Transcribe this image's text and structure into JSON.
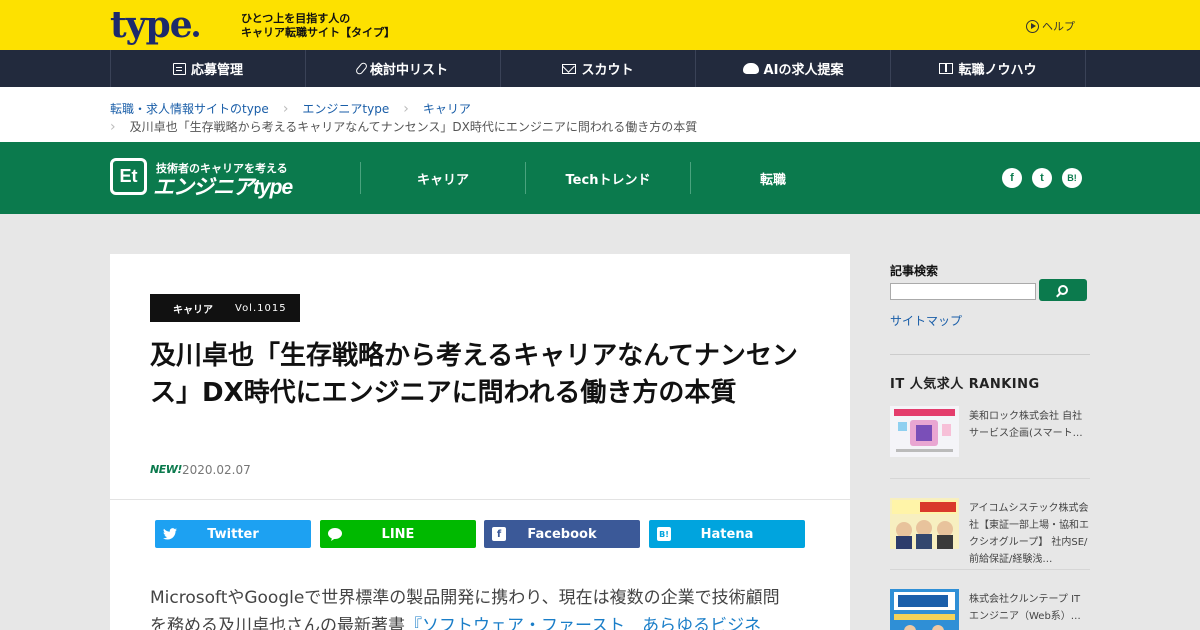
{
  "header": {
    "logo": "type",
    "tagline_line1": "ひとつ上を目指す人の",
    "tagline_line2": "キャリア転職サイト【タイプ】",
    "help": "ヘルプ"
  },
  "main_nav": [
    {
      "label": "応募管理",
      "icon": "document-icon"
    },
    {
      "label": "検討中リスト",
      "icon": "paperclip-icon"
    },
    {
      "label": "スカウト",
      "icon": "mail-icon"
    },
    {
      "label": "AIの求人提案",
      "icon": "ai-robot-icon"
    },
    {
      "label": "転職ノウハウ",
      "icon": "book-icon"
    }
  ],
  "breadcrumb": {
    "items": [
      "転職・求人情報サイトのtype",
      "エンジニアtype",
      "キャリア"
    ],
    "current": "及川卓也「生存戦略から考えるキャリアなんてナンセンス」DX時代にエンジニアに問われる働き方の本質"
  },
  "engineer_nav": {
    "logo_mark": "Et",
    "logo_small": "技術者のキャリアを考える",
    "logo_big": "エンジニアtype",
    "links": [
      "キャリア",
      "Techトレンド",
      "転職"
    ],
    "social": [
      "f",
      "t",
      "B!"
    ]
  },
  "article": {
    "category": "キャリア",
    "volume": "Vol.1015",
    "title": "及川卓也「生存戦略から考えるキャリアなんてナンセンス」DX時代にエンジニアに問われる働き方の本質",
    "new_label": "NEW!",
    "date": "2020.02.07",
    "share": [
      {
        "label": "Twitter",
        "color": "#1da1f2",
        "icon": "twitter-icon"
      },
      {
        "label": "LINE",
        "color": "#00b900",
        "icon": "line-icon"
      },
      {
        "label": "Facebook",
        "color": "#3b5998",
        "icon": "facebook-icon"
      },
      {
        "label": "Hatena",
        "color": "#00a4de",
        "icon": "hatena-icon"
      }
    ],
    "body_line1": "MicrosoftやGoogleで世界標準の製品開発に携わり、現在は複数の企業で技術顧問",
    "body_line2_prefix": "を務める及川卓也さんの最新著書",
    "body_line2_link": "『ソフトウェア・ファースト　あらゆるビジネ"
  },
  "sidebar": {
    "search_title": "記事検索",
    "search_placeholder": "",
    "sitemap": "サイトマップ",
    "ranking_title": "IT 人気求人 RANKING",
    "ranking": [
      {
        "text": "美和ロック株式会社 自社サービス企画(スマート…"
      },
      {
        "text": "アイコムシステック株式会社【東証一部上場・協和エクシオグループ】 社内SE/前給保証/経験浅…"
      },
      {
        "text": "株式会社クルンテープ ITエンジニア（Web系）…"
      }
    ]
  },
  "colors": {
    "brand_yellow": "#fde100",
    "nav_dark": "#222a3d",
    "engineer_green": "#0b7a4d",
    "link_blue": "#1a5ea8"
  }
}
